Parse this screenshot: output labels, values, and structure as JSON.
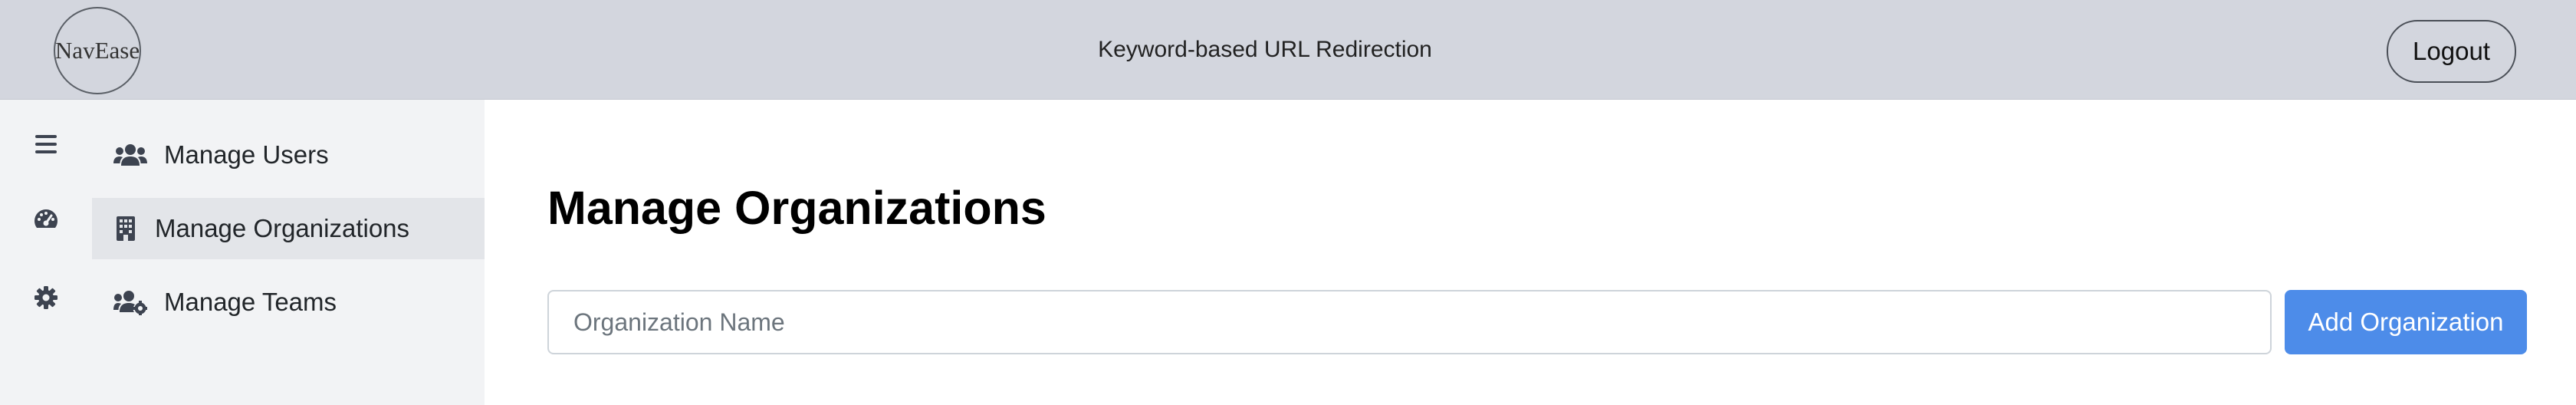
{
  "header": {
    "logo_text": "NavEase",
    "title": "Keyword-based URL Redirection",
    "logout_label": "Logout"
  },
  "icon_rail": {
    "items": [
      {
        "icon": "hamburger-menu-icon"
      },
      {
        "icon": "dashboard-gauge-icon"
      },
      {
        "icon": "gear-icon"
      }
    ]
  },
  "sidebar": {
    "items": [
      {
        "label": "Manage Users",
        "icon": "users-icon",
        "active": false
      },
      {
        "label": "Manage Organizations",
        "icon": "building-icon",
        "active": true
      },
      {
        "label": "Manage Teams",
        "icon": "users-gear-icon",
        "active": false
      }
    ]
  },
  "main": {
    "title": "Manage Organizations",
    "org_input": {
      "value": "",
      "placeholder": "Organization Name"
    },
    "add_label": "Add Organization"
  },
  "colors": {
    "header_bg": "#d3d6de",
    "sidebar_bg": "#f2f3f5",
    "active_item_bg": "#e3e5e9",
    "primary_button": "#4d8ce9",
    "icon_color": "#3d4350"
  }
}
